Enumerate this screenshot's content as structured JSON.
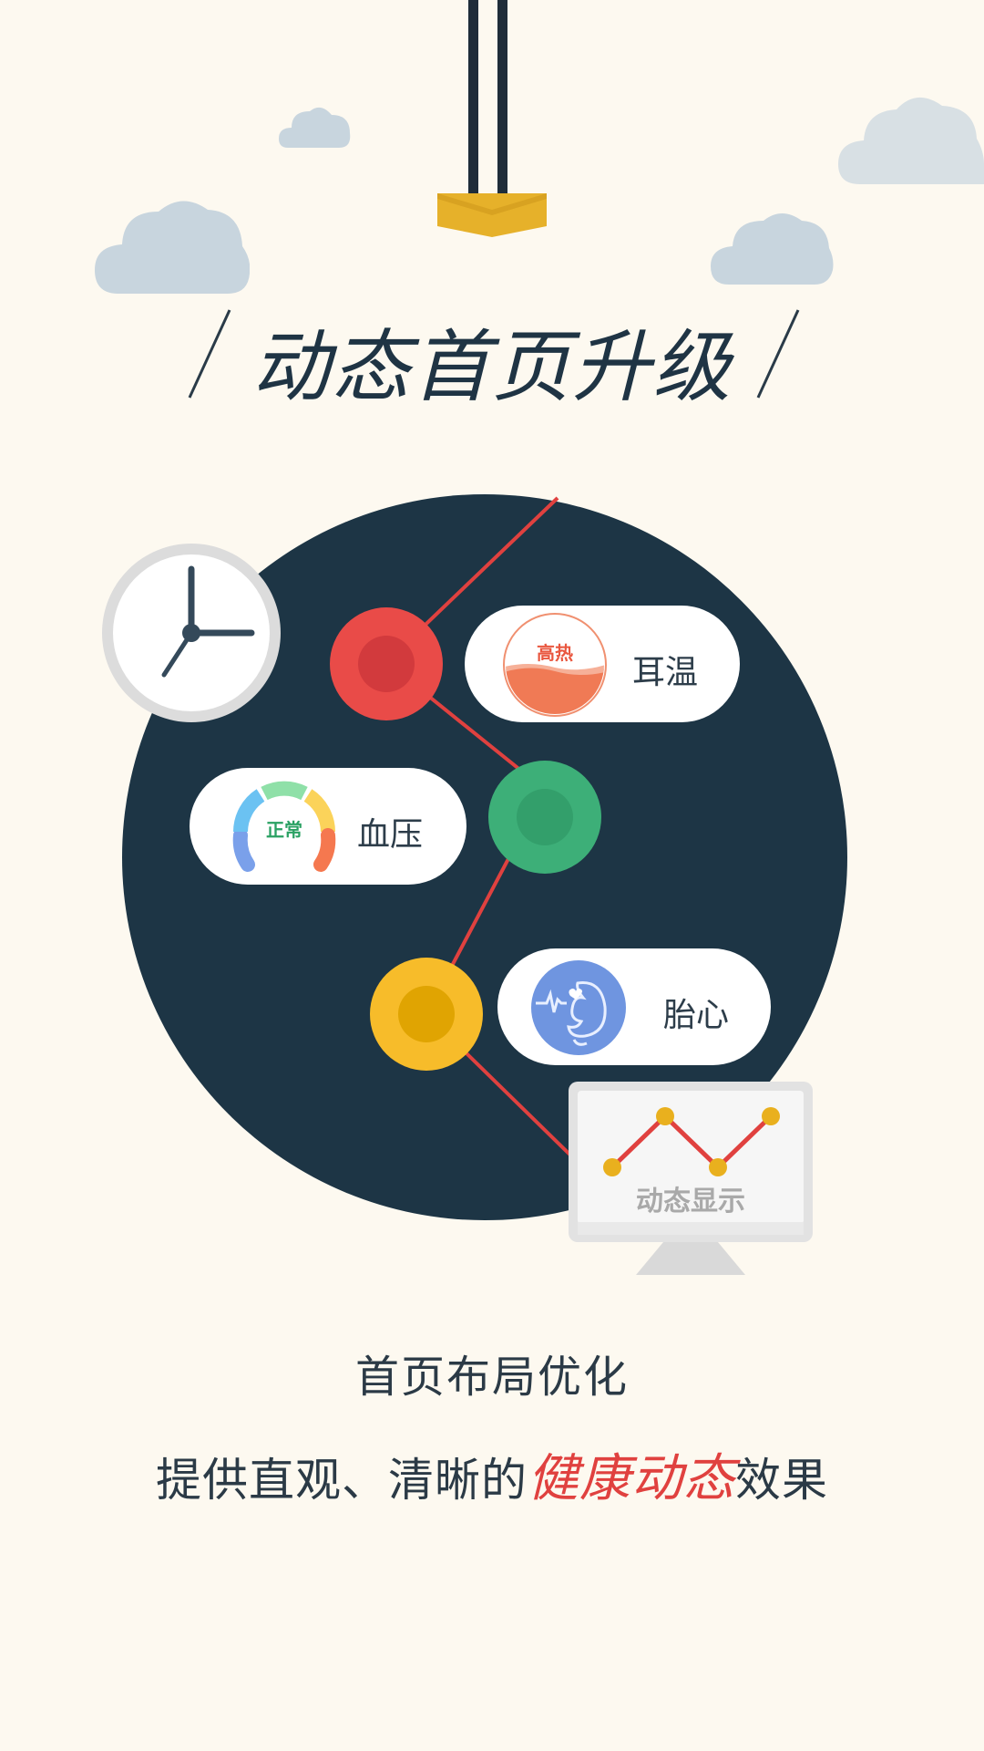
{
  "header": {
    "title": "动态首页升级"
  },
  "features": [
    {
      "label": "耳温",
      "badge": "高热",
      "node_color": "#e94b48",
      "node_inner": "#d23a3d"
    },
    {
      "label": "血压",
      "badge": "正常",
      "node_color": "#3daf78",
      "node_inner": "#339f6b"
    },
    {
      "label": "胎心",
      "badge": "",
      "node_color": "#f7bc2a",
      "node_inner": "#e0a402"
    }
  ],
  "monitor": {
    "label": "动态显示"
  },
  "footer": {
    "line1": "首页布局优化",
    "line2_prefix": "提供直观、清晰的",
    "line2_highlight": "健康动态",
    "line2_suffix": "效果"
  },
  "colors": {
    "background": "#fdf9f0",
    "circle": "#1d3545",
    "accent_red": "#e0413f",
    "arrow_yellow": "#e6b12a"
  }
}
